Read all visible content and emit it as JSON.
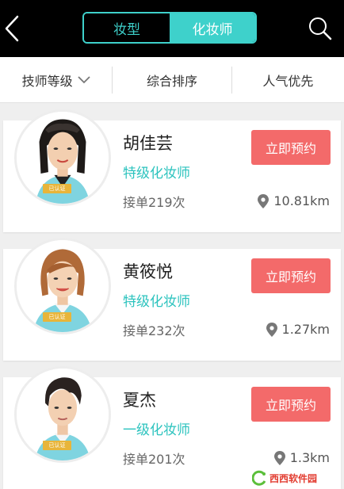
{
  "header": {
    "tabs": [
      {
        "label": "妆型",
        "active": false
      },
      {
        "label": "化妆师",
        "active": true
      }
    ]
  },
  "filters": [
    {
      "label": "技师等级",
      "has_dropdown": true
    },
    {
      "label": "综合排序",
      "has_dropdown": false
    },
    {
      "label": "人气优先",
      "has_dropdown": false
    }
  ],
  "artists": [
    {
      "name": "胡佳芸",
      "level": "特级化妆师",
      "orders": "接单219次",
      "distance": "10.81km",
      "badge": "已认证",
      "book_label": "立即预约"
    },
    {
      "name": "黄筱悦",
      "level": "特级化妆师",
      "orders": "接单232次",
      "distance": "1.27km",
      "badge": "已认证",
      "book_label": "立即预约"
    },
    {
      "name": "夏杰",
      "level": "一级化妆师",
      "orders": "接单201次",
      "distance": "1.3km",
      "badge": "已认证",
      "book_label": "立即预约"
    }
  ],
  "watermark": {
    "text": "西西软件园"
  },
  "colors": {
    "accent": "#3ed1cb",
    "book_button": "#f36a6a",
    "topbar": "#000000",
    "badge": "#e8b53a"
  },
  "icons": [
    "back-icon",
    "search-icon",
    "chevron-down-icon",
    "location-pin-icon"
  ]
}
